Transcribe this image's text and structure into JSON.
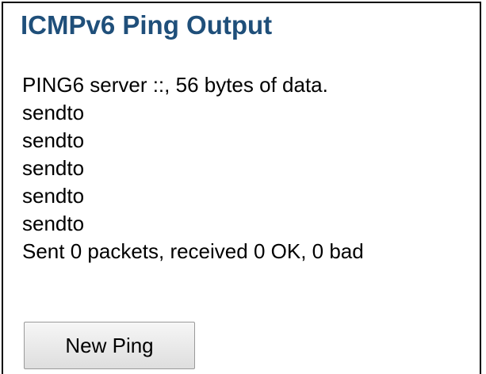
{
  "page": {
    "title": "ICMPv6 Ping Output"
  },
  "output": {
    "lines": [
      "PING6 server ::, 56 bytes of data.",
      "sendto",
      "sendto",
      "sendto",
      "sendto",
      "sendto",
      "Sent 0 packets, received 0 OK, 0 bad"
    ]
  },
  "actions": {
    "new_ping_label": "New Ping"
  }
}
